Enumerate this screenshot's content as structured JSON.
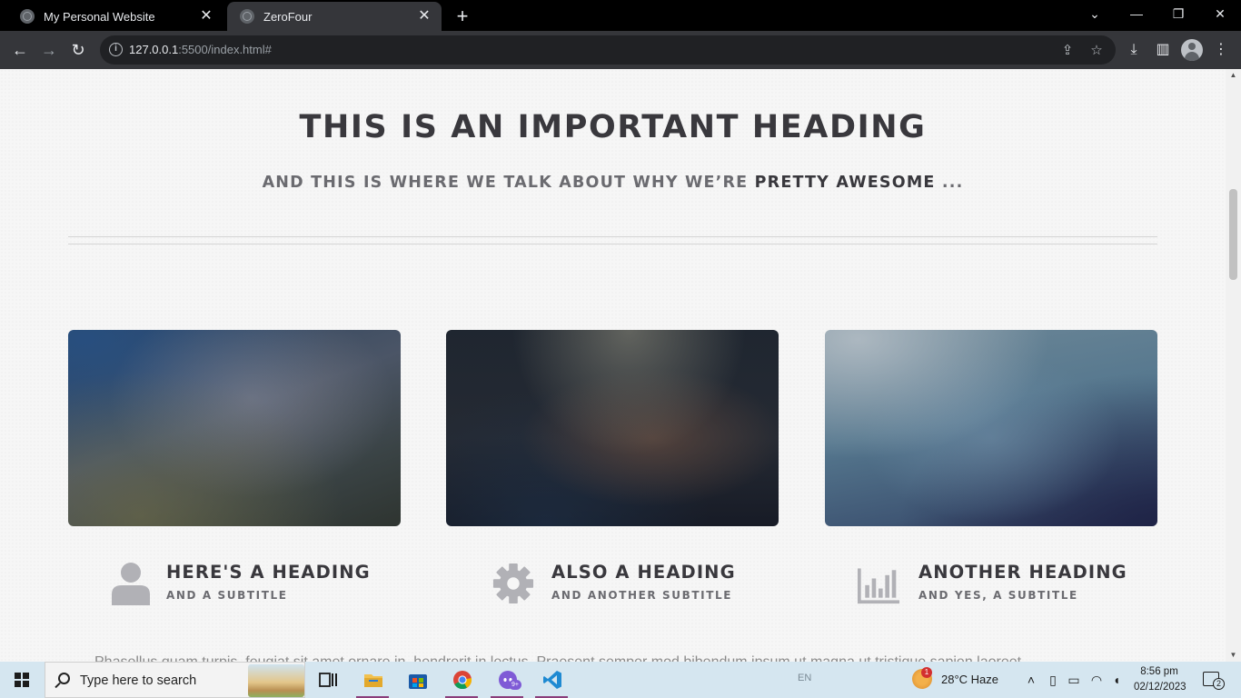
{
  "browser": {
    "tabs": [
      {
        "title": "My Personal Website",
        "active": false
      },
      {
        "title": "ZeroFour",
        "active": true
      }
    ],
    "tab_close_glyph": "✕",
    "new_tab_glyph": "+",
    "window_controls": {
      "tab_search": "⌄",
      "minimize": "—",
      "restore": "❐",
      "close": "✕"
    },
    "nav": {
      "back": "←",
      "forward": "→",
      "reload": "↻"
    },
    "address": {
      "host": "127.0.0.1",
      "rest": ":5500/index.html#"
    },
    "toolbar_icons": [
      "share-icon",
      "bookmark-star-icon",
      "download-icon",
      "side-panel-icon",
      "profile-icon",
      "menu-icon"
    ]
  },
  "page": {
    "heading": "THIS IS AN IMPORTANT HEADING",
    "subheading_prefix": "AND THIS IS WHERE WE TALK ABOUT WHY WE’RE ",
    "subheading_strong": "PRETTY AWESOME",
    "subheading_suffix": " ...",
    "features": [
      {
        "heading": "HERE'S A HEADING",
        "subtitle": "AND A SUBTITLE",
        "icon": "user-icon"
      },
      {
        "heading": "ALSO A HEADING",
        "subtitle": "AND ANOTHER SUBTITLE",
        "icon": "gear-icon"
      },
      {
        "heading": "ANOTHER HEADING",
        "subtitle": "AND YES, A SUBTITLE",
        "icon": "bar-chart-icon"
      }
    ],
    "body_text_partial": "Phasellus quam turpis, feugiat sit amet ornare in, hendrerit in lectus. Praesent semper mod bibendum ipsum ut magna ut tristique sapien laoreet."
  },
  "taskbar": {
    "search_placeholder": "Type here to search",
    "apps": [
      "task-view-icon",
      "file-explorer-icon",
      "microsoft-store-icon",
      "chrome-icon",
      "discord-icon",
      "vscode-icon"
    ],
    "discord_badge": "9+",
    "language": "EN",
    "weather_badge": "1",
    "weather": "28°C  Haze",
    "time": "8:56 pm",
    "date": "02/12/2023",
    "notification_count": "2"
  },
  "colors": {
    "heading": "#39383d",
    "subheading": "#6b6b70",
    "icon_gray": "#b1b1b6",
    "chrome_toolbar": "#35363a",
    "taskbar": "#d5e6f0"
  }
}
